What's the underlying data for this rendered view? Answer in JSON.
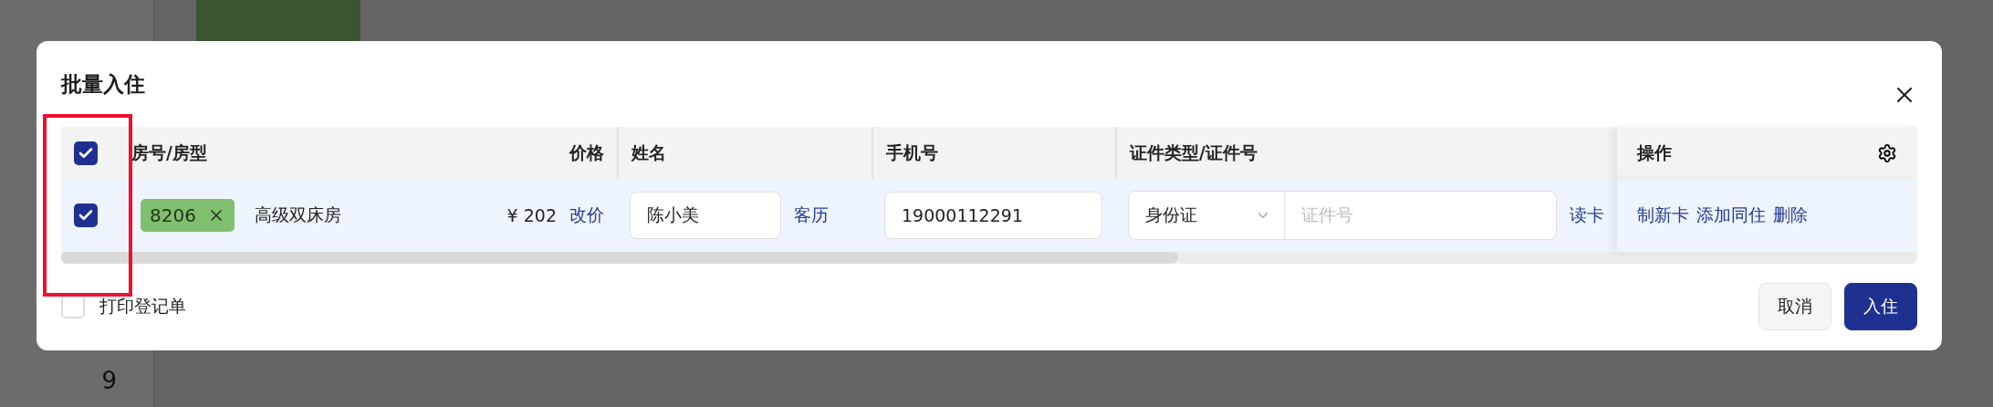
{
  "background": {
    "sidebar_counts": [
      "9"
    ]
  },
  "dialog": {
    "title": "批量入住",
    "table": {
      "header_checked": true,
      "columns": [
        "房号/房型",
        "价格",
        "姓名",
        "手机号",
        "证件类型/证件号",
        "操作"
      ],
      "rows": [
        {
          "selected": true,
          "room_tag": "8206",
          "room_type": "高级双床房",
          "price": "¥ 202",
          "price_action": "改价",
          "name": "陈小美",
          "history_action": "客历",
          "phone": "19000112291",
          "id_type": "身份证",
          "id_placeholder": "证件号",
          "read_action": "读卡",
          "actions": [
            "制新卡",
            "添加同住",
            "删除"
          ]
        }
      ]
    },
    "print_form": {
      "label": "打印登记单",
      "checked": false
    },
    "buttons": [
      {
        "label": "取消",
        "kind": "secondary"
      },
      {
        "label": "入住",
        "kind": "primary"
      }
    ]
  }
}
